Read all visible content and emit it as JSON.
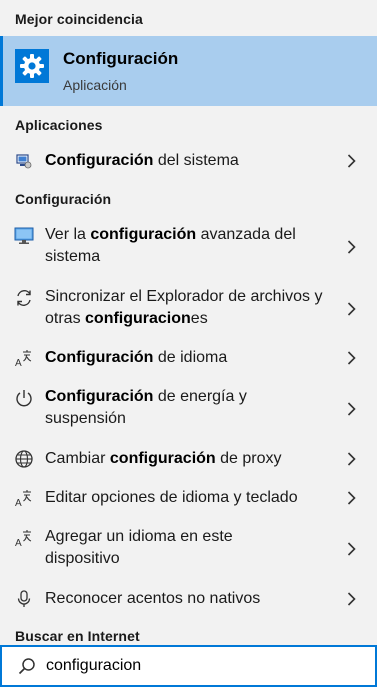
{
  "best_match": {
    "header": "Mejor coincidencia",
    "title": "Configuración",
    "subtitle": "Aplicación",
    "icon": "gear-icon",
    "accent_color": "#0078d7",
    "highlight_color": "#a9cdee"
  },
  "apps": {
    "header": "Aplicaciones",
    "items": [
      {
        "icon": "system-config-icon",
        "bold": "Configuración",
        "rest": " del sistema"
      }
    ]
  },
  "settings": {
    "header": "Configuración",
    "items": [
      {
        "icon": "monitor-icon",
        "parts": [
          "Ver la ",
          "configuración",
          " avanzada del sistema"
        ]
      },
      {
        "icon": "sync-icon",
        "parts": [
          "Sincronizar el Explorador de archivos y otras ",
          "configuracion",
          "es"
        ]
      },
      {
        "icon": "language-icon",
        "parts": [
          "",
          "Configuración",
          " de idioma"
        ]
      },
      {
        "icon": "power-icon",
        "parts": [
          "",
          "Configuración",
          " de energía y suspensión"
        ]
      },
      {
        "icon": "globe-icon",
        "parts": [
          "Cambiar ",
          "configuración",
          " de proxy"
        ]
      },
      {
        "icon": "language-icon",
        "parts": [
          "Editar opciones de idioma y teclado",
          "",
          ""
        ]
      },
      {
        "icon": "language-icon",
        "parts": [
          "Agregar un idioma en este dispositivo",
          "",
          ""
        ]
      },
      {
        "icon": "microphone-icon",
        "parts": [
          "Reconocer acentos no nativos",
          "",
          ""
        ]
      }
    ]
  },
  "internet": {
    "header": "Buscar en Internet"
  },
  "search": {
    "value": "configuracion",
    "icon": "search-icon",
    "border_color": "#0078d7"
  }
}
